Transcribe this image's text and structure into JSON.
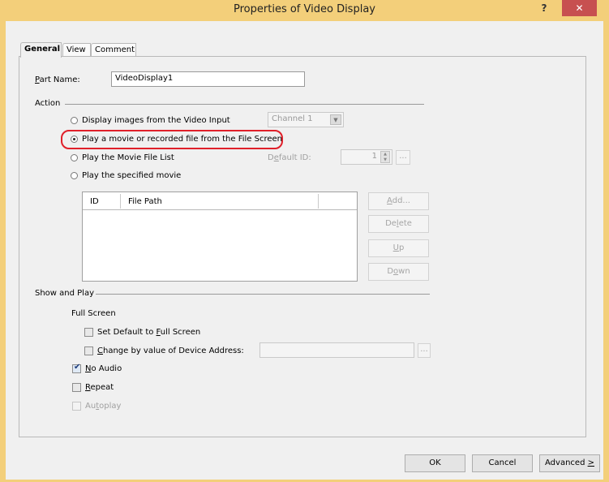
{
  "window": {
    "title": "Properties of Video Display",
    "help_label": "?",
    "close_label": "✕"
  },
  "tabs": [
    {
      "label": "General"
    },
    {
      "label": "View"
    },
    {
      "label": "Comment"
    }
  ],
  "part_name": {
    "label_prefix": "P",
    "label_rest": "art Name:",
    "value": "VideoDisplay1"
  },
  "action": {
    "group_label": "Action",
    "options": [
      {
        "label": "Display images from the Video Input"
      },
      {
        "label": "Play a movie or recorded file from the File Screen"
      },
      {
        "label": "Play the Movie File List"
      },
      {
        "label": "Play the specified movie"
      }
    ],
    "selected_index": 1,
    "channel_value": "Channel 1",
    "default_id_label_a": "D",
    "default_id_label_u": "e",
    "default_id_label_b": "fault ID:",
    "default_id_value": "1",
    "ellipsis": "..."
  },
  "file_list": {
    "columns": [
      "ID",
      "File Path"
    ],
    "buttons": {
      "add": {
        "a": "",
        "u": "A",
        "b": "dd..."
      },
      "delete": {
        "a": "De",
        "u": "l",
        "b": "ete"
      },
      "up": {
        "a": "",
        "u": "U",
        "b": "p"
      },
      "down": {
        "a": "D",
        "u": "o",
        "b": "wn"
      }
    }
  },
  "show_and_play": {
    "group_label": "Show and Play",
    "full_screen_label": "Full Screen",
    "set_default": {
      "a": "Set Default to ",
      "u": "F",
      "b": "ull Screen",
      "checked": false
    },
    "change_by": {
      "a": "",
      "u": "C",
      "b": "hange by value of Device Address:",
      "checked": false
    },
    "no_audio": {
      "a": "",
      "u": "N",
      "b": "o Audio",
      "checked": true
    },
    "repeat": {
      "a": "",
      "u": "R",
      "b": "epeat",
      "checked": false
    },
    "autoplay": {
      "a": "Au",
      "u": "t",
      "b": "oplay",
      "checked": false
    },
    "address_value": "",
    "ellipsis": "..."
  },
  "footer": {
    "ok": "OK",
    "cancel": "Cancel",
    "advanced_a": "Advanced ",
    "advanced_u": ">"
  }
}
